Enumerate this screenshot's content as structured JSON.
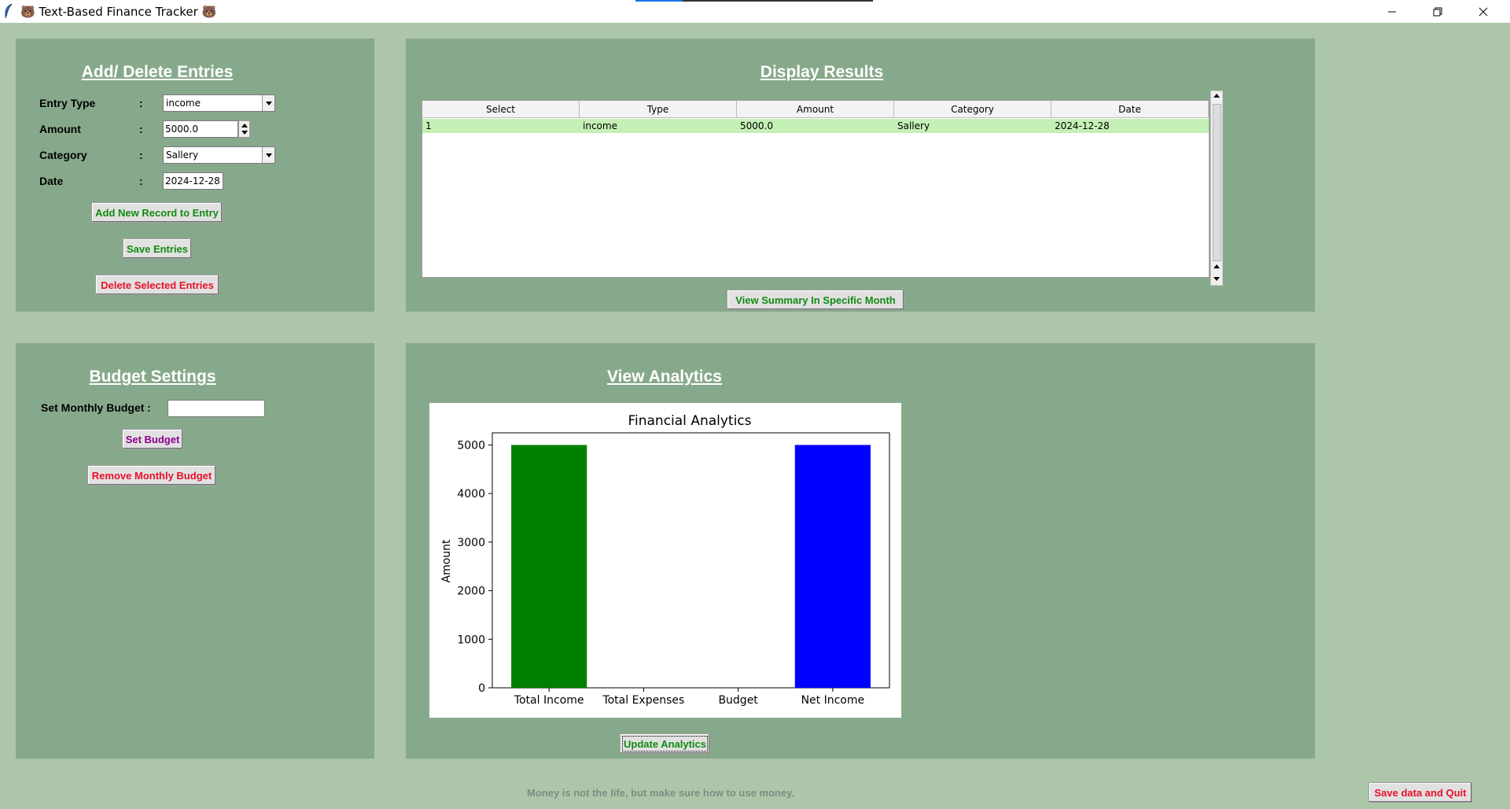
{
  "window": {
    "title": "Text-Based Finance Tracker",
    "title_emoji": "🐻"
  },
  "entries_panel": {
    "heading": "Add/ Delete Entries",
    "entry_type": {
      "label": "Entry Type",
      "colon": ":",
      "value": "income"
    },
    "amount": {
      "label": "Amount",
      "colon": ":",
      "value": "5000.0"
    },
    "category": {
      "label": "Category",
      "colon": ":",
      "value": "Sallery"
    },
    "date": {
      "label": "Date",
      "colon": ":",
      "value": "2024-12-28"
    },
    "add_button": "Add New Record to Entry",
    "save_button": "Save Entries",
    "delete_button": "Delete Selected Entries"
  },
  "results_panel": {
    "heading": "Display Results",
    "columns": [
      "Select",
      "Type",
      "Amount",
      "Category",
      "Date"
    ],
    "rows": [
      [
        "1",
        "income",
        "5000.0",
        "Sallery",
        "2024-12-28"
      ]
    ],
    "summary_button": "View Summary In Specific  Month"
  },
  "budget_panel": {
    "heading": "Budget Settings",
    "budget_label": "Set Monthly Budget",
    "colon": ":",
    "budget_value": "",
    "set_button": "Set Budget",
    "remove_button": "Remove Monthly Budget"
  },
  "analytics_panel": {
    "heading": "View Analytics",
    "update_button": "Update Analytics"
  },
  "chart_data": {
    "type": "bar",
    "title": "Financial Analytics",
    "xlabel": "",
    "ylabel": "Amount",
    "categories": [
      "Total Income",
      "Total Expenses",
      "Budget",
      "Net Income"
    ],
    "values": [
      5000,
      0,
      0,
      5000
    ],
    "colors": [
      "#008000",
      "#ff0000",
      "#800080",
      "#0000ff"
    ],
    "ylim": [
      0,
      5250
    ],
    "yticks": [
      0,
      1000,
      2000,
      3000,
      4000,
      5000
    ],
    "grid": false
  },
  "footer": {
    "quote": "Money is not the life, but make sure how to use money.",
    "quit_button": "Save data and Quit"
  }
}
